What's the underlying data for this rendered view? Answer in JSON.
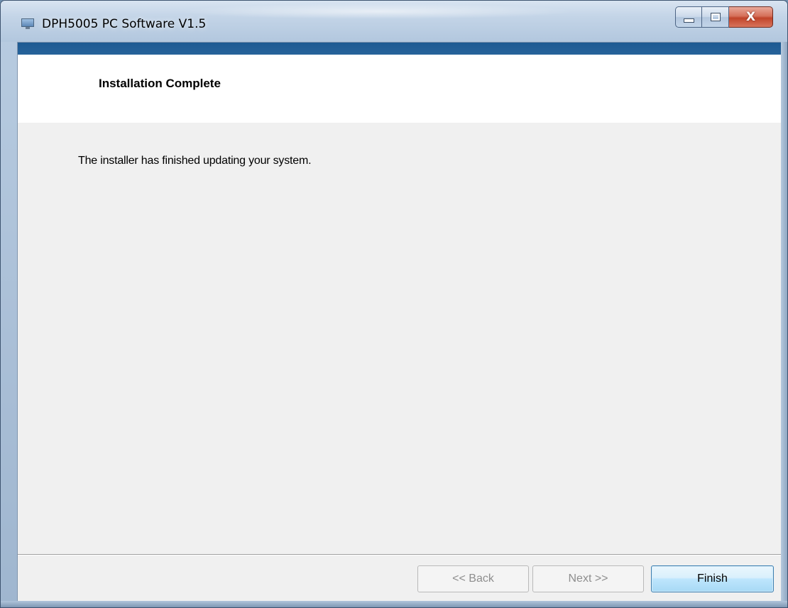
{
  "window": {
    "title": "DPH5005 PC Software V1.5",
    "icons": {
      "app": "computer-icon",
      "minimize": "minimize-icon",
      "maximize": "maximize-icon",
      "close": "close-icon"
    },
    "close_glyph": "X"
  },
  "header": {
    "title": "Installation Complete"
  },
  "main": {
    "message": "The installer has finished updating your system."
  },
  "footer": {
    "back_label": "<< Back",
    "next_label": "Next >>",
    "finish_label": "Finish"
  },
  "colors": {
    "accent_bar": "#1c5a92",
    "client_background": "#f0f0f0",
    "header_background": "#ffffff",
    "close_button": "#c0442a",
    "default_button_border": "#3c7fb1"
  }
}
